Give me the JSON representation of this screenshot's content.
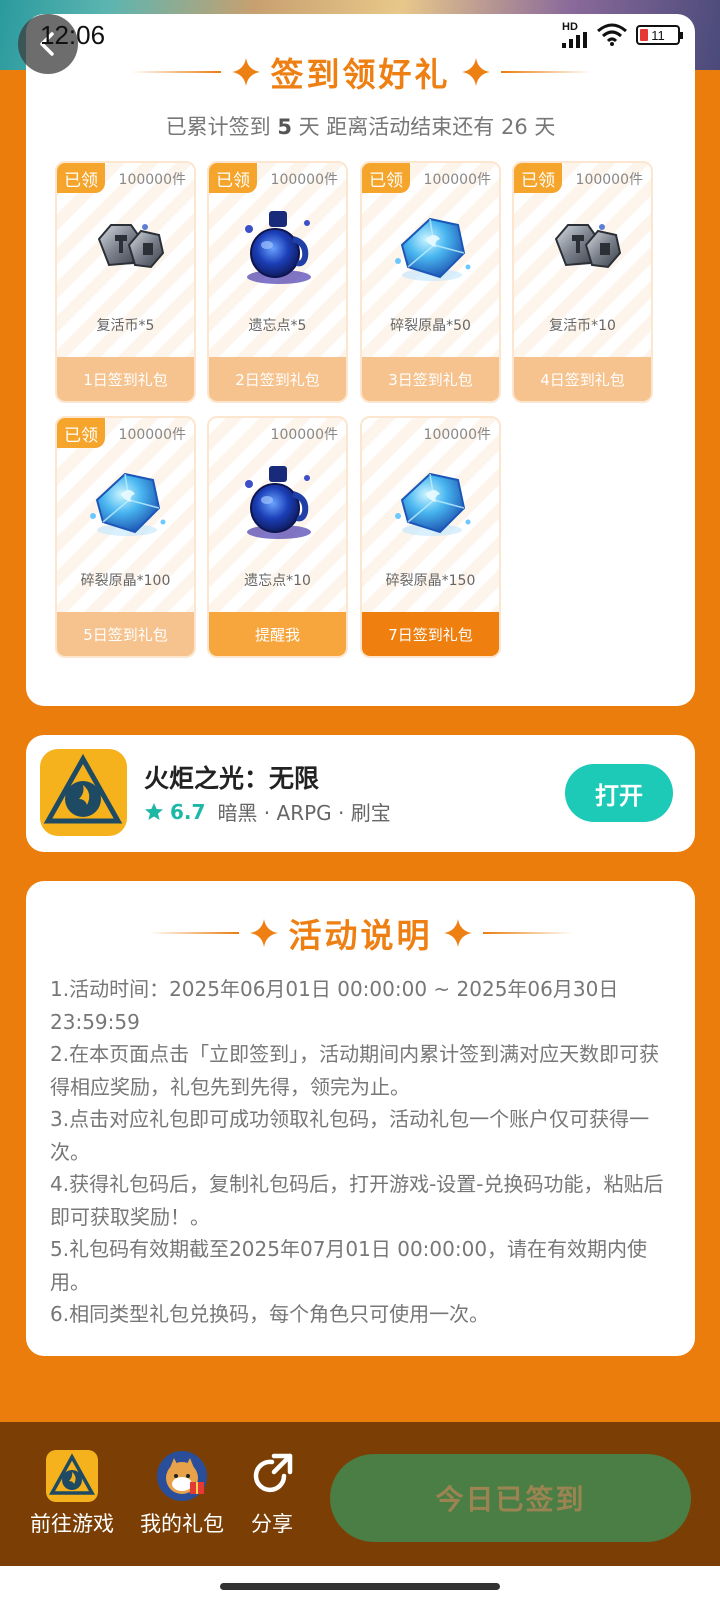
{
  "status_bar": {
    "time": "12:06",
    "battery": "11",
    "network": "HD"
  },
  "signin": {
    "title": "签到领好礼",
    "summary_prefix": "已累计签到",
    "summary_days": "5",
    "summary_mid": "天  距离活动结束还有 26 天",
    "gifts": [
      {
        "tag": "已领",
        "count": "100000件",
        "icon": "revive-coin",
        "name": "复活币*5",
        "button": "1日签到礼包"
      },
      {
        "tag": "已领",
        "count": "100000件",
        "icon": "oblivion-potion",
        "name": "遗忘点*5",
        "button": "2日签到礼包"
      },
      {
        "tag": "已领",
        "count": "100000件",
        "icon": "crystal-shard",
        "name": "碎裂原晶*50",
        "button": "3日签到礼包"
      },
      {
        "tag": "已领",
        "count": "100000件",
        "icon": "revive-coin",
        "name": "复活币*10",
        "button": "4日签到礼包"
      },
      {
        "tag": "已领",
        "count": "100000件",
        "icon": "crystal-shard",
        "name": "碎裂原晶*100",
        "button": "5日签到礼包"
      },
      {
        "tag": "",
        "count": "100000件",
        "icon": "oblivion-potion",
        "name": "遗忘点*10",
        "button": "提醒我"
      },
      {
        "tag": "",
        "count": "100000件",
        "icon": "crystal-shard",
        "name": "碎裂原晶*150",
        "button": "7日签到礼包"
      }
    ]
  },
  "app": {
    "name": "火炬之光：无限",
    "rating": "6.7",
    "tags": "暗黑 · ARPG · 刷宝",
    "open_label": "打开"
  },
  "rules": {
    "title": "活动说明",
    "items": [
      "1.活动时间：2025年06月01日 00:00:00 ~ 2025年06月30日 23:59:59",
      "2.在本页面点击「立即签到」，活动期间内累计签到满对应天数即可获得相应奖励，礼包先到先得，领完为止。",
      "3.点击对应礼包即可成功领取礼包码，活动礼包一个账户仅可获得一次。",
      "4.获得礼包码后，复制礼包码后，打开游戏-设置-兑换码功能，粘贴后即可获取奖励！。",
      "5.礼包码有效期截至2025年07月01日 00:00:00，请在有效期内使用。",
      "6.相同类型礼包兑换码，每个角色只可使用一次。"
    ]
  },
  "bottom_bar": {
    "go_game": "前往游戏",
    "my_gifts": "我的礼包",
    "share": "分享",
    "signed": "今日已签到"
  },
  "colors": {
    "page_bg": "#ea7d0c",
    "accent": "#ee7f12",
    "teal": "#1dc9b7",
    "bottom_bg": "#7b3f05",
    "signed_btn": "#4a7e45"
  }
}
